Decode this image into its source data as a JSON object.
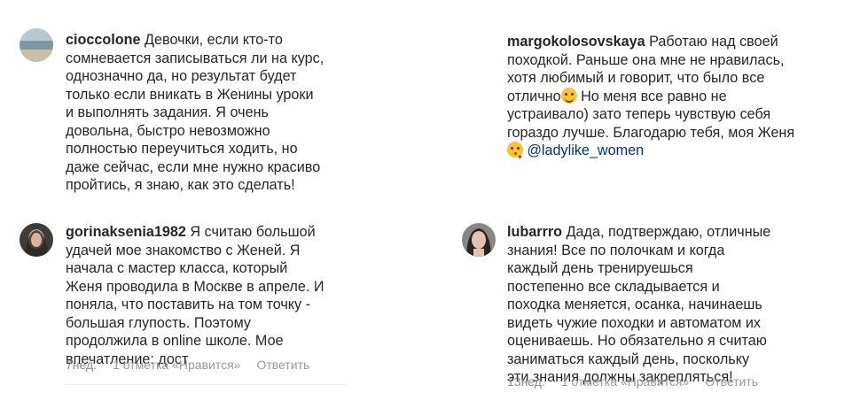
{
  "comments": [
    {
      "username": "cioccolone",
      "text": " Девочки, если кто-то\nсомневается записываться ли на курс,\nоднозначно да, но результат будет\nтолько если вникать в Женины уроки\nи выполнять задания. Я очень\nдовольна, быстро невозможно\nполностью переучиться ходить, но\nдаже сейчас, если мне нужно красиво\nпройтись, я знаю, как это сделать!"
    },
    {
      "username": "margokolosovskaya",
      "text_1": " Работаю над своей\nпоходкой. Раньше она мне не нравилась,\nхотя любимый и говорит, что было все\nотлично",
      "text_2": "  Но меня все равно не\nустраивало) зато теперь чувствую себя\nгораздо лучше. Благодарю тебя, моя Женя\n",
      "mention": "@ladylike_women",
      "emoji_1": "smiling-face-icon",
      "emoji_2": "face-blowing-kiss-icon"
    },
    {
      "username": "gorinaksenia1982",
      "text": " Я считаю большой\nудачей мое знакомство с Женей. Я\nначала с мастер класса, который\nЖеня проводила в Москве в апреле. И\nпоняла, что поставить на том точку -\nбольшая глупость. Поэтому\nпродолжила в online школе. Мое\nвпечатление: дост",
      "time": "7нед.",
      "likes": "1 отметка «Нравится»",
      "reply": "Ответить"
    },
    {
      "username": "lubarrro",
      "text": " Дада, подтверждаю, отличные\nзнания! Все по полочкам и когда\nкаждый день тренируешься\nпостепенно все складывается и\nпоходка меняется, осанка, начинаешь\nвидеть чужие походки и автоматом их\nоцениваешь. Но обязательно я считаю\nзаниматься каждый день, поскольку\nэти знания должны закрепляться!",
      "time": "13нед.",
      "likes": "1 отметка «Нравится»",
      "reply": "Ответить"
    }
  ]
}
